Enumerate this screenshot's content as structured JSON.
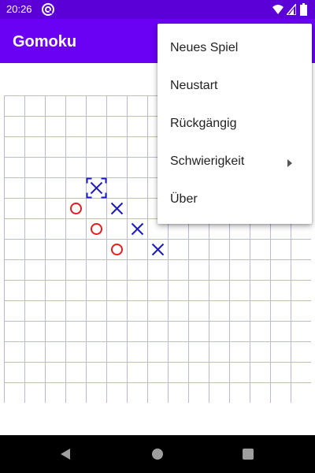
{
  "status_bar": {
    "time": "20:26",
    "app_icon": "notification-app-icon",
    "wifi_icon": "wifi-icon",
    "signal_icon": "signal-icon",
    "battery_icon": "battery-icon"
  },
  "app_bar": {
    "title": "Gomoku"
  },
  "overflow_menu": {
    "items": [
      {
        "label": "Neues Spiel"
      },
      {
        "label": "Neustart"
      },
      {
        "label": "Rückgängig"
      },
      {
        "label": "Schwierigkeit",
        "has_submenu": true
      },
      {
        "label": "Über"
      }
    ]
  },
  "board": {
    "columns": 15,
    "rows": 15,
    "grid_color": "#b8b8e8",
    "x_color": "#1a1ad1",
    "o_color": "#e01e1e",
    "stones": [
      {
        "col": 4,
        "row": 4,
        "piece": "X",
        "selected": true
      },
      {
        "col": 3,
        "row": 5,
        "piece": "O"
      },
      {
        "col": 5,
        "row": 5,
        "piece": "X"
      },
      {
        "col": 4,
        "row": 6,
        "piece": "O"
      },
      {
        "col": 6,
        "row": 6,
        "piece": "X"
      },
      {
        "col": 5,
        "row": 7,
        "piece": "O"
      },
      {
        "col": 7,
        "row": 7,
        "piece": "X"
      }
    ]
  },
  "nav_bar": {
    "back_icon": "back-icon",
    "home_icon": "home-icon",
    "recents_icon": "recents-icon"
  },
  "colors": {
    "status_bar": "#5b00d6",
    "app_bar": "#6a00f4",
    "nav_bar": "#000000"
  }
}
